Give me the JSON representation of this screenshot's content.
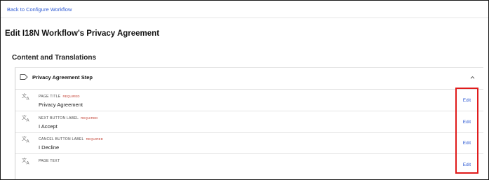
{
  "nav": {
    "back_label": "Back to Configure Workflow"
  },
  "page": {
    "title": "Edit I18N Workflow's Privacy Agreement"
  },
  "section": {
    "title": "Content and Translations"
  },
  "accordion": {
    "title": "Privacy Agreement Step",
    "expanded": true,
    "rows": [
      {
        "label": "PAGE TITLE",
        "required": "REQUIRED",
        "value": "Privacy Agreement",
        "edit": "Edit"
      },
      {
        "label": "NEXT BUTTON LABEL",
        "required": "REQUIRED",
        "value": "I Accept",
        "edit": "Edit"
      },
      {
        "label": "CANCEL BUTTON LABEL",
        "required": "REQUIRED",
        "value": "I Decline",
        "edit": "Edit"
      },
      {
        "label": "PAGE TEXT",
        "required": "",
        "value": "",
        "edit": "Edit"
      }
    ]
  },
  "icons": {
    "accordion": "tag-icon",
    "toggle": "chevron-up-icon",
    "row": "translate-icon"
  },
  "colors": {
    "link": "#2f5bd3",
    "required": "#c0392b",
    "highlight": "#e01b1b"
  }
}
